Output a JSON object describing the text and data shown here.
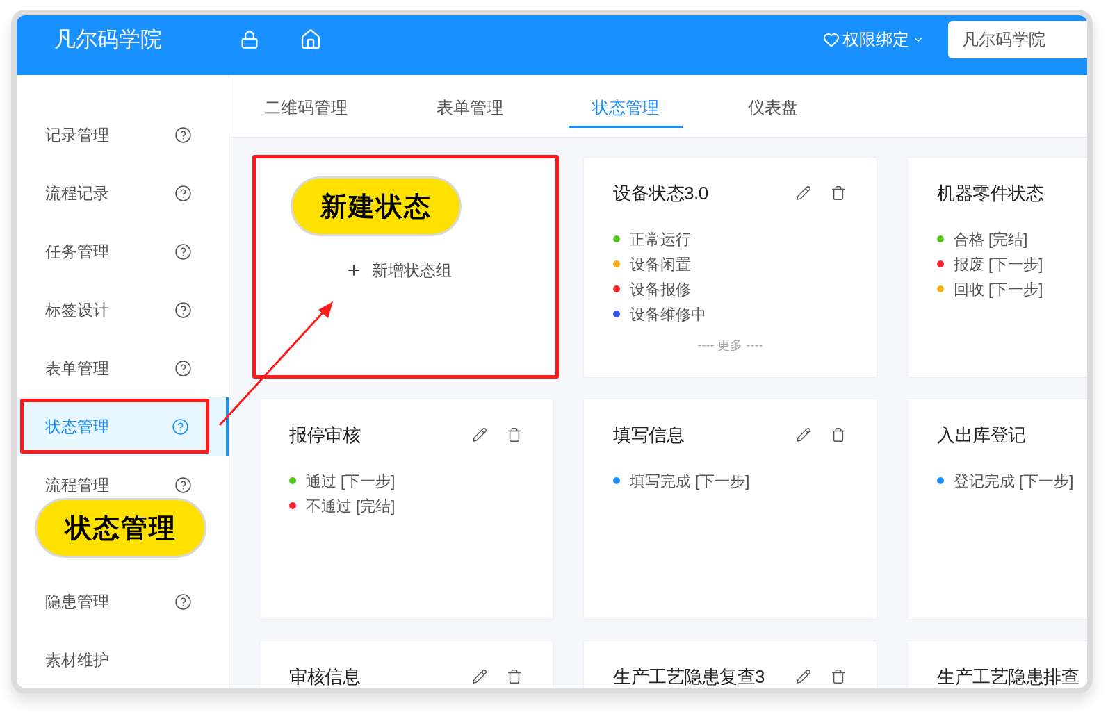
{
  "header": {
    "logo": "凡尔码学院",
    "menu": "权限绑定",
    "field_value": "凡尔码学院"
  },
  "sidebar": {
    "items": [
      {
        "label": "记录管理",
        "help": true,
        "selected": false
      },
      {
        "label": "流程记录",
        "help": true,
        "selected": false
      },
      {
        "label": "任务管理",
        "help": true,
        "selected": false
      },
      {
        "label": "标签设计",
        "help": true,
        "selected": false
      },
      {
        "label": "表单管理",
        "help": true,
        "selected": false
      },
      {
        "label": "状态管理",
        "help": true,
        "selected": true
      },
      {
        "label": "流程管理",
        "help": true,
        "selected": false
      },
      {
        "label": "隐患管理",
        "help": true,
        "selected": false
      },
      {
        "label": "素材维护",
        "help": false,
        "selected": false
      }
    ]
  },
  "tabs": [
    {
      "label": "二维码管理",
      "selected": false
    },
    {
      "label": "表单管理",
      "selected": false
    },
    {
      "label": "状态管理",
      "selected": true
    },
    {
      "label": "仪表盘",
      "selected": false
    }
  ],
  "new_card": {
    "label": "新增状态组"
  },
  "cards": [
    {
      "title": "设备状态3.0",
      "actions": true,
      "statuses": [
        {
          "label": "正常运行",
          "color": "#52c41a"
        },
        {
          "label": "设备闲置",
          "color": "#faad14"
        },
        {
          "label": "设备报修",
          "color": "#f5222d"
        },
        {
          "label": "设备维修中",
          "color": "#2f54eb"
        }
      ],
      "more": "---- 更多 ----"
    },
    {
      "title": "机器零件状态",
      "statuses": [
        {
          "label": "合格 [完结]",
          "color": "#52c41a"
        },
        {
          "label": "报废 [下一步]",
          "color": "#f5222d"
        },
        {
          "label": "回收 [下一步]",
          "color": "#faad14"
        }
      ]
    },
    {
      "title": "报停审核",
      "actions": true,
      "statuses": [
        {
          "label": "通过 [下一步]",
          "color": "#52c41a"
        },
        {
          "label": "不通过 [完结]",
          "color": "#f5222d"
        }
      ]
    },
    {
      "title": "填写信息",
      "actions": true,
      "statuses": [
        {
          "label": "填写完成 [下一步]",
          "color": "#1890ff"
        }
      ]
    },
    {
      "title": "入出库登记",
      "statuses": [
        {
          "label": "登记完成 [下一步]",
          "color": "#1890ff"
        }
      ]
    },
    {
      "title": "审核信息",
      "actions": true
    },
    {
      "title": "生产工艺隐患复查3",
      "actions": true
    },
    {
      "title": "生产工艺隐患排查"
    }
  ],
  "annotations": {
    "card_callout": "新建状态",
    "sidebar_callout": "状态管理"
  }
}
